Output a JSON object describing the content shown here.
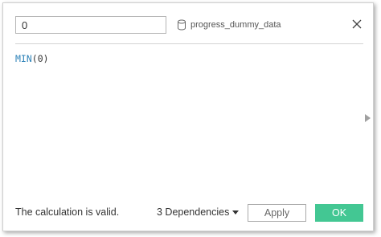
{
  "calculation": {
    "name_value": "0",
    "datasource_label": "progress_dummy_data",
    "formula_function": "MIN",
    "formula_args": "(0)"
  },
  "footer": {
    "status_text": "The calculation is valid.",
    "dependencies_label": "3 Dependencies",
    "apply_label": "Apply",
    "ok_label": "OK"
  },
  "icons": {
    "datasource": "database-icon",
    "close": "close-icon",
    "expand": "triangle-right-icon",
    "dropdown": "caret-down-icon"
  },
  "colors": {
    "ok_button": "#43c793",
    "function_keyword": "#2d82b8"
  }
}
